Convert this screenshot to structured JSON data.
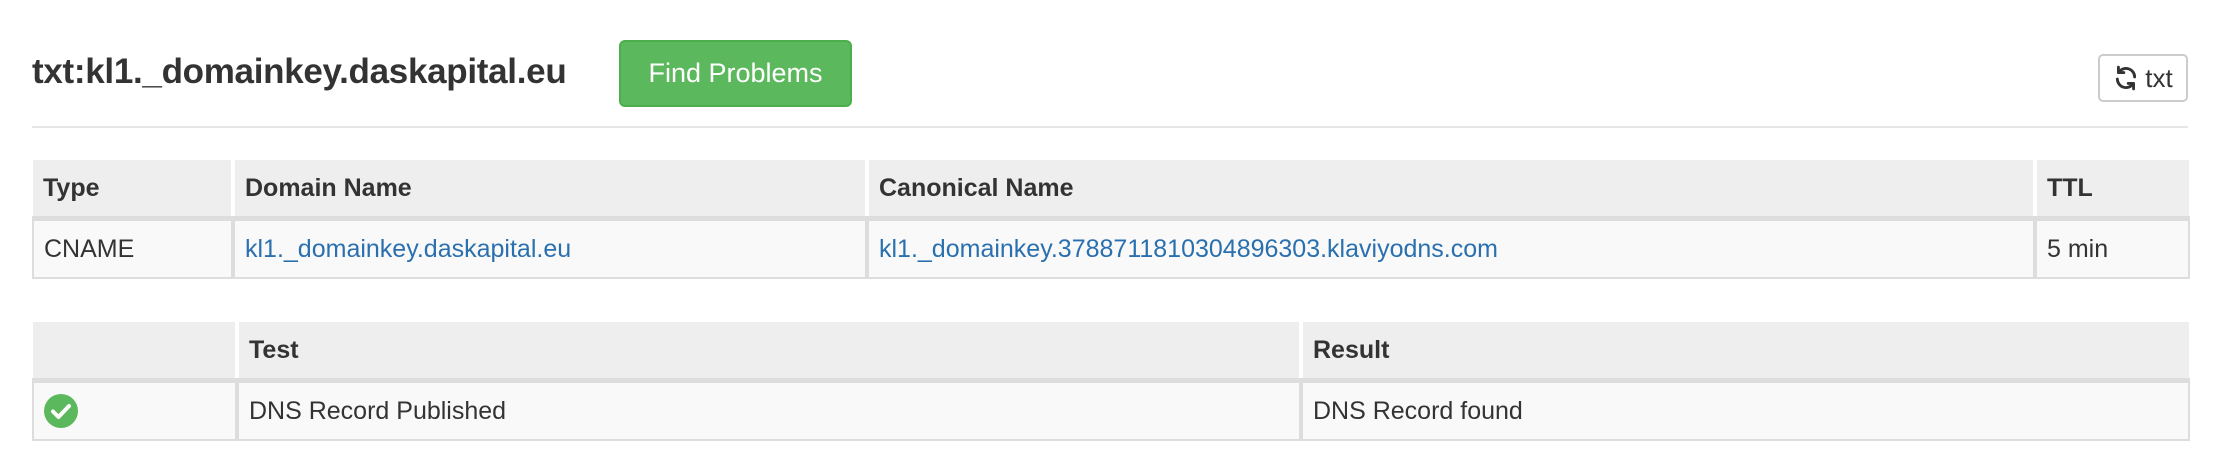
{
  "header": {
    "title": "txt:kl1._domainkey.daskapital.eu",
    "find_problems_label": "Find Problems",
    "refresh_label": "txt"
  },
  "records_table": {
    "columns": [
      "Type",
      "Domain Name",
      "Canonical Name",
      "TTL"
    ],
    "rows": [
      {
        "type": "CNAME",
        "domain_name": "kl1._domainkey.daskapital.eu",
        "canonical_name": "kl1._domainkey.3788711810304896303.klaviyodns.com",
        "ttl": "5 min"
      }
    ]
  },
  "tests_table": {
    "columns": [
      "",
      "Test",
      "Result"
    ],
    "rows": [
      {
        "status_icon": "check-circle-icon",
        "test": "DNS Record Published",
        "result": "DNS Record found"
      }
    ]
  },
  "colors": {
    "success": "#5cb85c",
    "link": "#2a6fae",
    "header_bg": "#eeeeee",
    "row_bg": "#f9f9f9"
  }
}
